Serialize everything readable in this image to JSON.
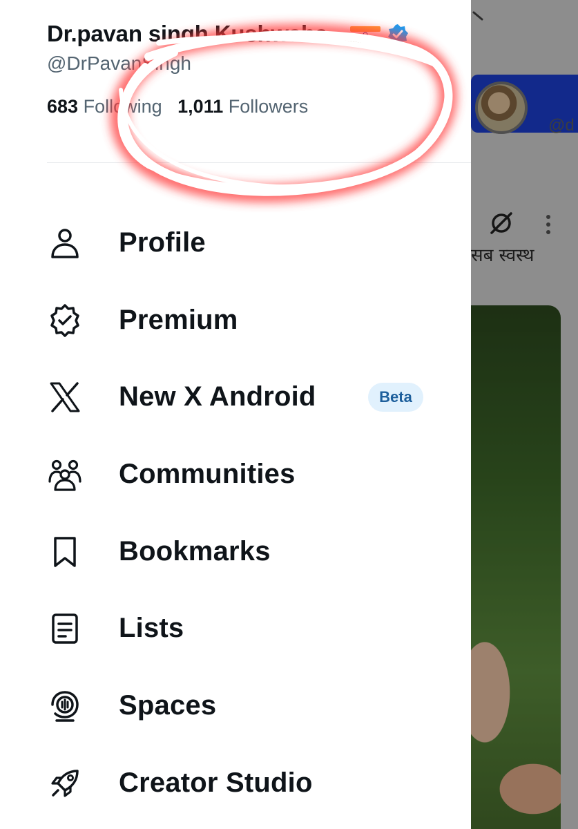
{
  "profile": {
    "display_name": "Dr.pavan singh Kushwaha",
    "handle": "@DrPavanSingh",
    "following_count": "683",
    "following_label": "Following",
    "followers_count": "1,011",
    "followers_label": "Followers"
  },
  "menu": [
    {
      "label": "Profile",
      "icon": "person-icon"
    },
    {
      "label": "Premium",
      "icon": "verified-badge-icon"
    },
    {
      "label": "New X Android",
      "icon": "x-logo-icon",
      "badge": "Beta"
    },
    {
      "label": "Communities",
      "icon": "communities-icon"
    },
    {
      "label": "Bookmarks",
      "icon": "bookmark-icon"
    },
    {
      "label": "Lists",
      "icon": "list-icon"
    },
    {
      "label": "Spaces",
      "icon": "spaces-icon"
    },
    {
      "label": "Creator Studio",
      "icon": "rocket-icon"
    }
  ],
  "background_page": {
    "handle_fragment": "@d",
    "hindi_text": "सब स्वस्थ"
  },
  "colors": {
    "annotation": "#ff3b3b",
    "verified": "#1d9bf0",
    "beta_bg": "#e1f1fd",
    "beta_text": "#1d5f9c",
    "banner": "#1d3fd6"
  }
}
